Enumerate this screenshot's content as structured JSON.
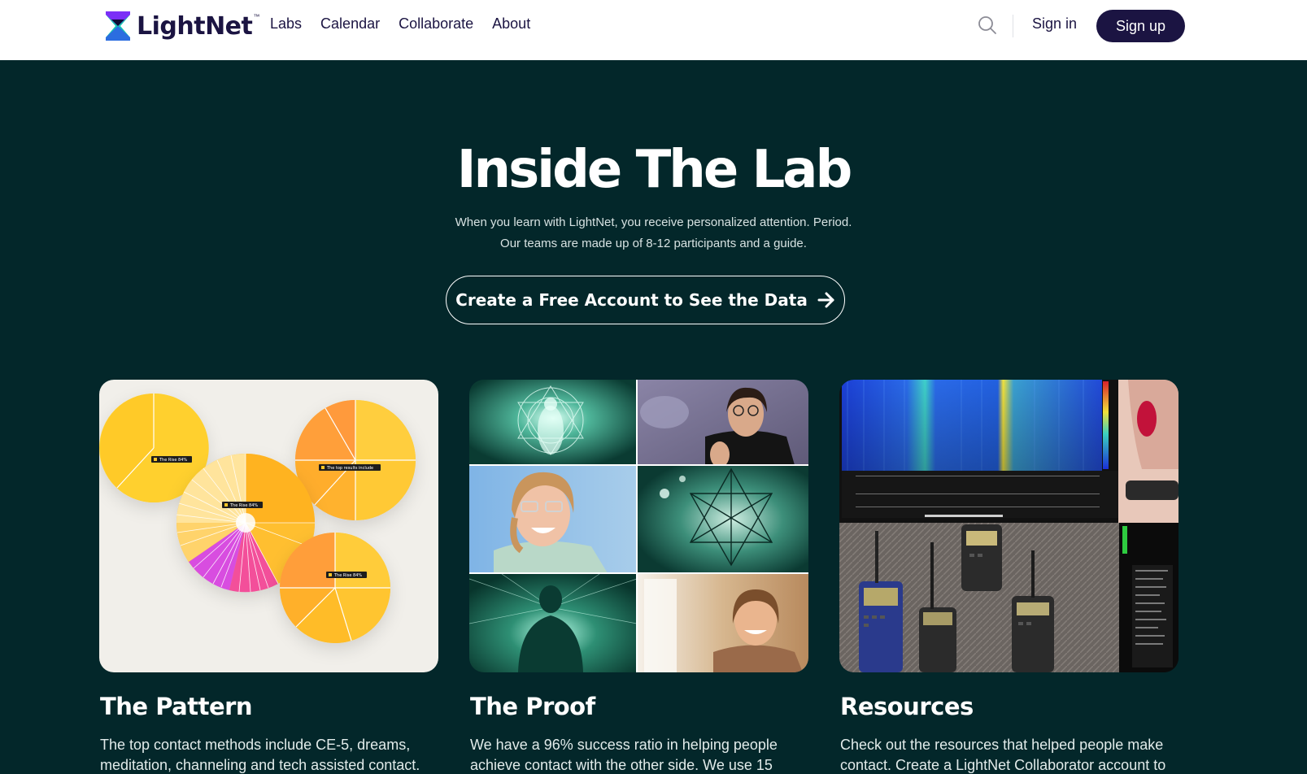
{
  "brand": {
    "name": "LightNet",
    "trademark": "™",
    "colors": {
      "navy": "#1b1442",
      "teal_bg": "#03272a",
      "logo_purple": "#7b2ff7",
      "logo_teal": "#17c3b2"
    }
  },
  "header": {
    "nav": [
      "Labs",
      "Calendar",
      "Collaborate",
      "About"
    ],
    "search_icon": "search-icon",
    "signin_label": "Sign in",
    "signup_label": "Sign up"
  },
  "hero": {
    "title": "Inside The Lab",
    "subtitle_line1": "When you learn with LightNet, you receive personalized attention. Period.",
    "subtitle_line2": "Our teams are made up of 8-12 participants and a guide.",
    "cta_label": "Create a Free Account to See the Data",
    "cta_icon": "arrow-right-icon"
  },
  "cards": [
    {
      "title": "The Pattern",
      "desc": "The top contact methods include CE-5, dreams, meditation, channeling and tech assisted contact.",
      "image_labels": [
        "The Rise 84%",
        "The top results include",
        "The Rise 84%",
        "The Rise 84%"
      ]
    },
    {
      "title": "The Proof",
      "desc": "We have a 96% success ratio in helping people achieve contact with the other side. We use 15"
    },
    {
      "title": "Resources",
      "desc": "Check out the resources that helped people make contact. Create a LightNet Collaborator account to"
    }
  ]
}
